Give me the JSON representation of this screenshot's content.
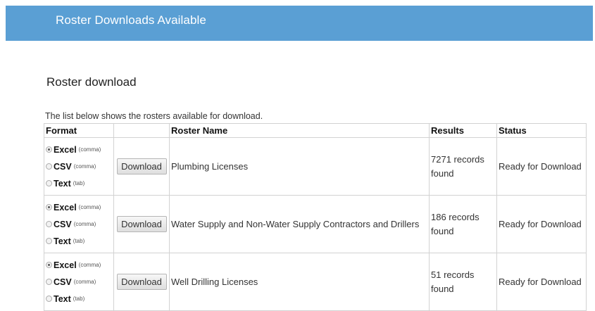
{
  "header": {
    "title": "Roster Downloads Available"
  },
  "page": {
    "title": "Roster download",
    "intro": "The list below shows the rosters available for download."
  },
  "table": {
    "columns": {
      "format": "Format",
      "action": "",
      "name": "Roster Name",
      "results": "Results",
      "status": "Status"
    },
    "format_options": [
      {
        "name": "Excel",
        "separator": "(comma)"
      },
      {
        "name": "CSV",
        "separator": "(comma)"
      },
      {
        "name": "Text",
        "separator": "(tab)"
      }
    ],
    "rows": [
      {
        "selected_format": "Excel",
        "button": "Download",
        "name": "Plumbing Licenses",
        "results": "7271 records found",
        "status": "Ready for Download"
      },
      {
        "selected_format": "Excel",
        "button": "Download",
        "name": "Water Supply and Non-Water Supply Contractors and Drillers",
        "results": "186 records found",
        "status": "Ready for Download"
      },
      {
        "selected_format": "Excel",
        "button": "Download",
        "name": "Well Drilling Licenses",
        "results": "51 records found",
        "status": "Ready for Download"
      }
    ]
  },
  "colors": {
    "header_bg": "#5a9fd4",
    "header_text": "#ffffff",
    "border": "#d2d2d2"
  }
}
